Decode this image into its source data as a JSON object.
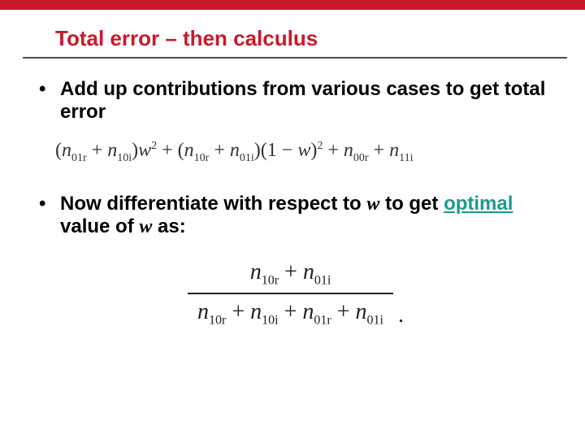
{
  "accent_color": "#c8192b",
  "title": "Total error – then calculus",
  "bullets": {
    "b1": "Add up contributions from various cases to get total error",
    "b2_pre": "Now differentiate with respect to ",
    "b2_var": "w",
    "b2_mid": " to get ",
    "b2_opt": "optimal",
    "b2_post1": " value of ",
    "b2_var2": "w",
    "b2_post2": " as:"
  },
  "formula1": {
    "lp1": "(",
    "t1": "n",
    "t1s": "01r",
    "plus1": " + ",
    "t2": "n",
    "t2s": "10i",
    "rp1": ")",
    "w2": "w",
    "w2e": "2",
    "plus2": " + ",
    "lp2": "(",
    "t3": "n",
    "t3s": "10r",
    "plus3": " + ",
    "t4": "n",
    "t4s": "01i",
    "rp2": ")",
    "oneMinus_open": "(1 − ",
    "wv": "w",
    "oneMinus_close": ")",
    "oneMinus_e": "2",
    "plus4": " + ",
    "t5": "n",
    "t5s": "00r",
    "plus5": " + ",
    "t6": "n",
    "t6s": "11i"
  },
  "formula2": {
    "num": {
      "a": "n",
      "as": "10r",
      "plus": " + ",
      "b": "n",
      "bs": "01i"
    },
    "den": {
      "a": "n",
      "as": "10r",
      "p1": " + ",
      "b": "n",
      "bs": "10i",
      "p2": " + ",
      "c": "n",
      "cs": "01r",
      "p3": " + ",
      "d": "n",
      "ds": "01i"
    },
    "dot": "."
  }
}
